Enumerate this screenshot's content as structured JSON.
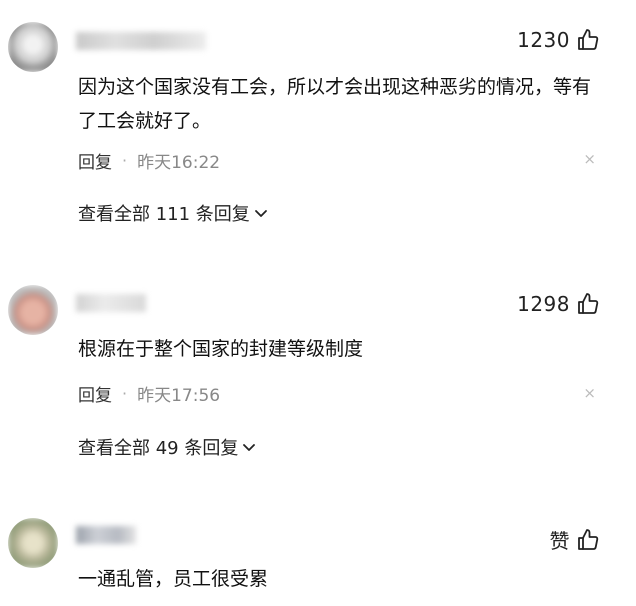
{
  "comments": [
    {
      "likes": "1230",
      "text": "因为这个国家没有工会，所以才会出现这种恶劣的情况，等有了工会就好了。",
      "reply_label": "回复",
      "separator": "·",
      "time": "昨天16:22",
      "dismiss": "×",
      "more_replies": "查看全部 111 条回复"
    },
    {
      "likes": "1298",
      "text": "根源在于整个国家的封建等级制度",
      "reply_label": "回复",
      "separator": "·",
      "time": "昨天17:56",
      "dismiss": "×",
      "more_replies": "查看全部 49 条回复"
    },
    {
      "likes": "赞",
      "text": "一通乱管，员工很受累"
    }
  ],
  "icons": {
    "like": "thumbs-up-icon",
    "expand": "chevron-down-icon",
    "dismiss": "close-icon"
  },
  "colors": {
    "text": "#111111",
    "meta": "#888888",
    "dismiss": "#bbbbbb"
  }
}
